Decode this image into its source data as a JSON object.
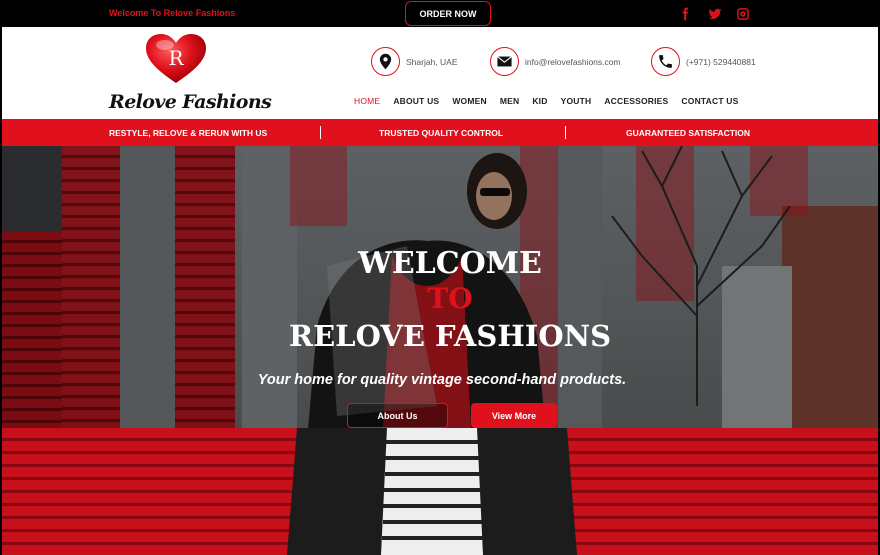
{
  "topbar": {
    "welcome": "Welcome To Relove Fashions",
    "order_label": "ORDER NOW",
    "social": [
      "facebook-icon",
      "twitter-icon",
      "instagram-icon"
    ]
  },
  "header": {
    "logo_letter": "R",
    "logo_text": "Relove Fashions",
    "contacts": {
      "location": "Sharjah, UAE",
      "email": "info@relovefashions.com",
      "phone": "(+971) 529440881"
    },
    "nav": [
      "HOME",
      "ABOUT US",
      "WOMEN",
      "MEN",
      "KID",
      "YOUTH",
      "ACCESSORIES",
      "CONTACT US"
    ],
    "active_nav": "HOME"
  },
  "strip": {
    "items": [
      "RESTYLE, RELOVE & RERUN WITH US",
      "TRUSTED QUALITY CONTROL",
      "GUARANTEED SATISFACTION"
    ]
  },
  "hero": {
    "line1": "WELCOME",
    "line2": "TO",
    "line3": "RELOVE FASHIONS",
    "tagline": "Your home for quality vintage second-hand products.",
    "about_label": "About Us",
    "more_label": "View More"
  },
  "colors": {
    "accent": "#e0111d",
    "topbar": "#000000",
    "header": "#ffffff"
  }
}
